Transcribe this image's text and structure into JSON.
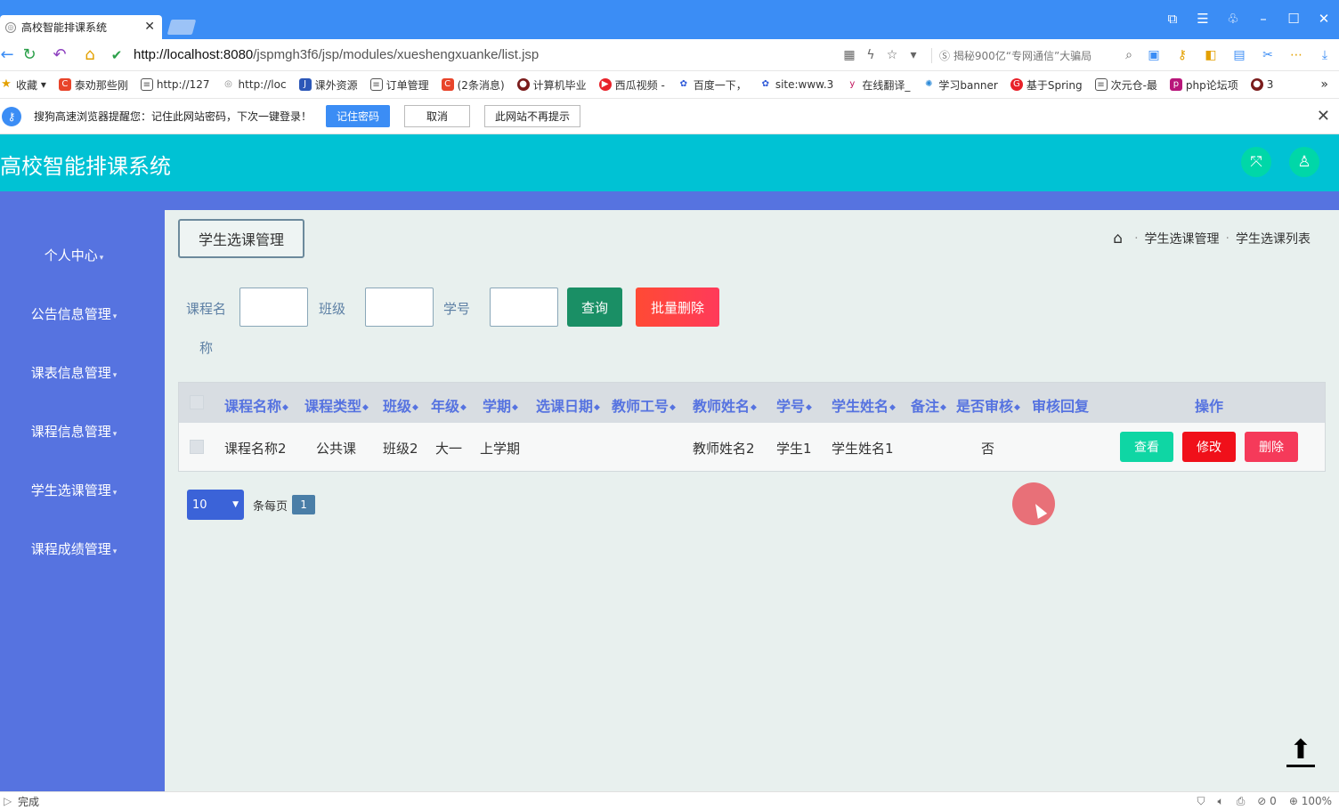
{
  "browser": {
    "tab_title": "高校智能排课系统",
    "url_host": "http://localhost:8080",
    "url_path": "/jspmgh3f6/jsp/modules/xueshengxuanke/list.jsp",
    "search_text": "揭秘900亿“专网通信”大骗局",
    "bookmarks": [
      "收藏",
      "泰劝那些刚",
      "http://127",
      "http://loc",
      "课外资源",
      "订单管理",
      "(2条消息)",
      "计算机毕业",
      "西瓜视频 -",
      "百度一下，",
      "site:www.3",
      "在线翻译_",
      "学习banner",
      "基于Spring",
      "次元仓-最",
      "php论坛项",
      "3"
    ],
    "notify_text": "搜狗高速浏览器提醒您：记住此网站密码，下次一键登录！",
    "notify_remember": "记住密码",
    "notify_cancel": "取消",
    "notify_never": "此网站不再提示",
    "status_left": "完成",
    "zoom": "100%",
    "status_count": "0"
  },
  "app": {
    "title": "高校智能排课系统",
    "sidebar": [
      {
        "label": "个人中心"
      },
      {
        "label": "公告信息管理"
      },
      {
        "label": "课表信息管理"
      },
      {
        "label": "课程信息管理"
      },
      {
        "label": "学生选课管理"
      },
      {
        "label": "课程成绩管理"
      }
    ],
    "page_title": "学生选课管理",
    "breadcrumb": [
      "学生选课管理",
      "学生选课列表"
    ],
    "search": {
      "course_label_1": "课程名",
      "course_label_2": "称",
      "class_label": "班级",
      "student_no_label": "学号",
      "query_button": "查询",
      "batch_delete_button": "批量删除"
    },
    "table": {
      "headers": [
        "课程名称",
        "课程类型",
        "班级",
        "年级",
        "学期",
        "选课日期",
        "教师工号",
        "教师姓名",
        "学号",
        "学生姓名",
        "备注",
        "是否审核",
        "审核回复",
        "操作"
      ],
      "rows": [
        {
          "course_name": "课程名称2",
          "course_type": "公共课",
          "class": "班级2",
          "grade": "大一",
          "semester": "上学期",
          "select_date": "",
          "teacher_no": "",
          "teacher_name": "教师姓名2",
          "student_no": "学生1",
          "student_name": "学生姓名1",
          "remark": "",
          "audited": "否",
          "audit_reply": ""
        }
      ],
      "actions": {
        "view": "查看",
        "edit": "修改",
        "delete": "删除"
      }
    },
    "pager": {
      "page_size": "10",
      "per_page_label": "条每页",
      "current_page": "1"
    }
  },
  "colors": {
    "header": "#00c2d4",
    "sidebar": "#5673e0",
    "main_bg": "#e8f0ee",
    "view_btn": "#0fd6a4",
    "edit_btn": "#f0101a",
    "delete_btn": "#f53a5a"
  }
}
